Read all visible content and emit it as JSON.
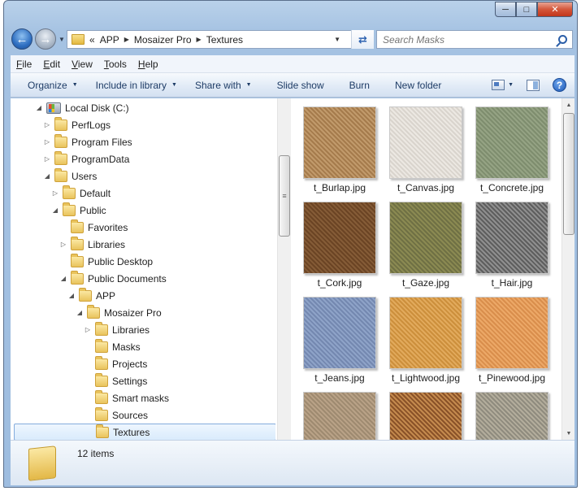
{
  "address": {
    "crumbs": [
      "APP",
      "Mosaizer Pro",
      "Textures"
    ],
    "overflow_glyph": "«"
  },
  "search": {
    "placeholder": "Search Masks"
  },
  "menu": [
    "File",
    "Edit",
    "View",
    "Tools",
    "Help"
  ],
  "commands": [
    {
      "label": "Organize",
      "dropdown": true
    },
    {
      "label": "Include in library",
      "dropdown": true
    },
    {
      "label": "Share with",
      "dropdown": true
    },
    {
      "label": "Slide show",
      "dropdown": false
    },
    {
      "label": "Burn",
      "dropdown": false
    },
    {
      "label": "New folder",
      "dropdown": false
    }
  ],
  "tree": [
    {
      "label": "Local Disk (C:)",
      "level": 0,
      "expander": "expanded",
      "icon": "drive"
    },
    {
      "label": "PerfLogs",
      "level": 1,
      "expander": "collapsed",
      "icon": "folder"
    },
    {
      "label": "Program Files",
      "level": 1,
      "expander": "collapsed",
      "icon": "folder"
    },
    {
      "label": "ProgramData",
      "level": 1,
      "expander": "collapsed",
      "icon": "folder"
    },
    {
      "label": "Users",
      "level": 1,
      "expander": "expanded",
      "icon": "folder"
    },
    {
      "label": "Default",
      "level": 2,
      "expander": "collapsed",
      "icon": "folder"
    },
    {
      "label": "Public",
      "level": 2,
      "expander": "expanded",
      "icon": "folder"
    },
    {
      "label": "Favorites",
      "level": 3,
      "expander": "none",
      "icon": "folder"
    },
    {
      "label": "Libraries",
      "level": 3,
      "expander": "collapsed",
      "icon": "folder"
    },
    {
      "label": "Public Desktop",
      "level": 3,
      "expander": "none",
      "icon": "folder"
    },
    {
      "label": "Public Documents",
      "level": 3,
      "expander": "expanded",
      "icon": "folder"
    },
    {
      "label": "APP",
      "level": 4,
      "expander": "expanded",
      "icon": "folder"
    },
    {
      "label": "Mosaizer Pro",
      "level": 5,
      "expander": "expanded",
      "icon": "folder"
    },
    {
      "label": "Libraries",
      "level": 6,
      "expander": "collapsed",
      "icon": "folder"
    },
    {
      "label": "Masks",
      "level": 6,
      "expander": "none",
      "icon": "folder"
    },
    {
      "label": "Projects",
      "level": 6,
      "expander": "none",
      "icon": "folder"
    },
    {
      "label": "Settings",
      "level": 6,
      "expander": "none",
      "icon": "folder"
    },
    {
      "label": "Smart masks",
      "level": 6,
      "expander": "none",
      "icon": "folder"
    },
    {
      "label": "Sources",
      "level": 6,
      "expander": "none",
      "icon": "folder"
    },
    {
      "label": "Textures",
      "level": 6,
      "expander": "none",
      "icon": "folder",
      "selected": true
    }
  ],
  "files": [
    {
      "name": "t_Burlap.jpg",
      "colors": [
        "#c19a6b",
        "#a57b4c"
      ]
    },
    {
      "name": "t_Canvas.jpg",
      "colors": [
        "#ece8e2",
        "#d9d4cd"
      ]
    },
    {
      "name": "t_Concrete.jpg",
      "colors": [
        "#95a384",
        "#7e8d6e"
      ]
    },
    {
      "name": "t_Cork.jpg",
      "colors": [
        "#855c37",
        "#6b4424"
      ]
    },
    {
      "name": "t_Gaze.jpg",
      "colors": [
        "#8b8a52",
        "#6f7044"
      ]
    },
    {
      "name": "t_Hair.jpg",
      "colors": [
        "#8f8f8f",
        "#5e5e5e"
      ]
    },
    {
      "name": "t_Jeans.jpg",
      "colors": [
        "#8ea3c8",
        "#7488b0"
      ]
    },
    {
      "name": "t_Lightwood.jpg",
      "colors": [
        "#e2aa5c",
        "#cc8f3c"
      ]
    },
    {
      "name": "t_Pinewood.jpg",
      "colors": [
        "#eca867",
        "#d98e4c"
      ]
    },
    {
      "name": "",
      "colors": [
        "#b9a287",
        "#9e8a70"
      ]
    },
    {
      "name": "",
      "colors": [
        "#c48a4e",
        "#8a5228"
      ]
    },
    {
      "name": "",
      "colors": [
        "#b3ad9c",
        "#8f8b7e"
      ]
    }
  ],
  "status": {
    "item_count": "12 items"
  }
}
